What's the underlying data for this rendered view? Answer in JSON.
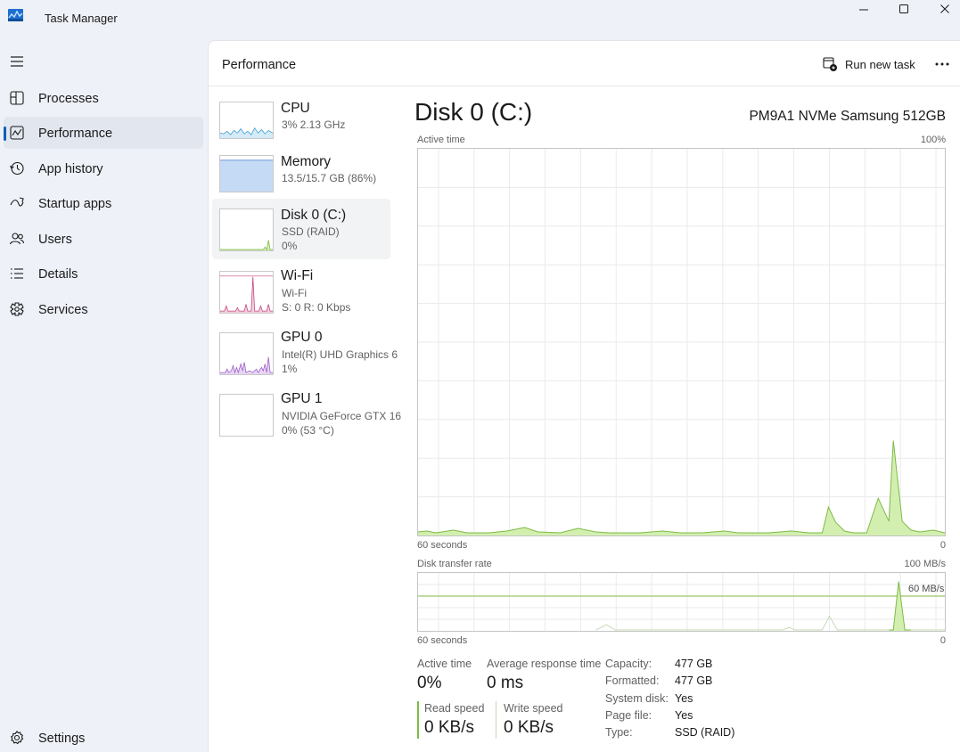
{
  "window": {
    "title": "Task Manager"
  },
  "nav": {
    "items": [
      {
        "label": "Processes",
        "icon": "processes-icon"
      },
      {
        "label": "Performance",
        "icon": "performance-icon",
        "active": true
      },
      {
        "label": "App history",
        "icon": "app-history-icon"
      },
      {
        "label": "Startup apps",
        "icon": "startup-apps-icon"
      },
      {
        "label": "Users",
        "icon": "users-icon"
      },
      {
        "label": "Details",
        "icon": "details-icon"
      },
      {
        "label": "Services",
        "icon": "services-icon"
      }
    ],
    "settings_label": "Settings"
  },
  "header": {
    "title": "Performance",
    "run_task_label": "Run new task"
  },
  "devices": [
    {
      "name": "CPU",
      "line1": "3%  2.13 GHz",
      "line2": "",
      "color": "#3b9ad2"
    },
    {
      "name": "Memory",
      "line1": "13.5/15.7 GB (86%)",
      "line2": "",
      "color": "#5b8ed6"
    },
    {
      "name": "Disk 0 (C:)",
      "line1": "SSD (RAID)",
      "line2": "0%",
      "color": "#6fae3c"
    },
    {
      "name": "Wi-Fi",
      "line1": "Wi-Fi",
      "line2": "S: 0  R: 0 Kbps",
      "color": "#c4437e"
    },
    {
      "name": "GPU 0",
      "line1": "Intel(R) UHD Graphics 6",
      "line2": "1%",
      "color": "#9b5cc8"
    },
    {
      "name": "GPU 1",
      "line1": "NVIDIA GeForce GTX 16",
      "line2": "0%  (53 °C)",
      "color": "#9b5cc8"
    }
  ],
  "disk": {
    "title": "Disk 0 (C:)",
    "model": "PM9A1 NVMe Samsung 512GB",
    "active_time_graph": {
      "label": "Active time",
      "max": "100%",
      "time_label": "60 seconds",
      "min": "0"
    },
    "transfer_graph": {
      "label": "Disk transfer rate",
      "max": "100 MB/s",
      "ref_line": "60 MB/s",
      "time_label": "60 seconds",
      "min": "0"
    },
    "stats": {
      "active_time_label": "Active time",
      "active_time": "0%",
      "avg_response_label": "Average response time",
      "avg_response": "0 ms",
      "read_label": "Read speed",
      "read": "0 KB/s",
      "write_label": "Write speed",
      "write": "0 KB/s"
    },
    "props": [
      {
        "k": "Capacity:",
        "v": "477 GB"
      },
      {
        "k": "Formatted:",
        "v": "477 GB"
      },
      {
        "k": "System disk:",
        "v": "Yes"
      },
      {
        "k": "Page file:",
        "v": "Yes"
      },
      {
        "k": "Type:",
        "v": "SSD (RAID)"
      }
    ]
  },
  "colors": {
    "accent": "#0a5fb8",
    "disk_fill": "#d3efb0",
    "disk_stroke": "#7dbb45"
  }
}
